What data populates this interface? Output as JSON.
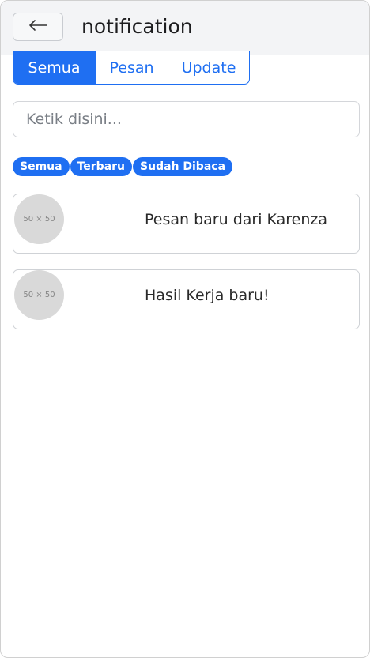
{
  "header": {
    "back_icon": "arrow-left-icon",
    "title": "notification"
  },
  "tabs": [
    {
      "label": "Semua",
      "active": true
    },
    {
      "label": "Pesan",
      "active": false
    },
    {
      "label": "Update",
      "active": false
    }
  ],
  "search": {
    "placeholder": "Ketik disini...",
    "value": ""
  },
  "filters": [
    {
      "label": "Semua"
    },
    {
      "label": "Terbaru"
    },
    {
      "label": "Sudah Dibaca"
    }
  ],
  "notifications": [
    {
      "avatar_text": "50 × 50",
      "text": "Pesan baru dari Karenza"
    },
    {
      "avatar_text": "50 × 50",
      "text": "Hasil Kerja baru!"
    }
  ],
  "colors": {
    "primary": "#1f6ff2",
    "header_bg": "#f3f4f6",
    "avatar_bg": "#d9d9d9"
  }
}
